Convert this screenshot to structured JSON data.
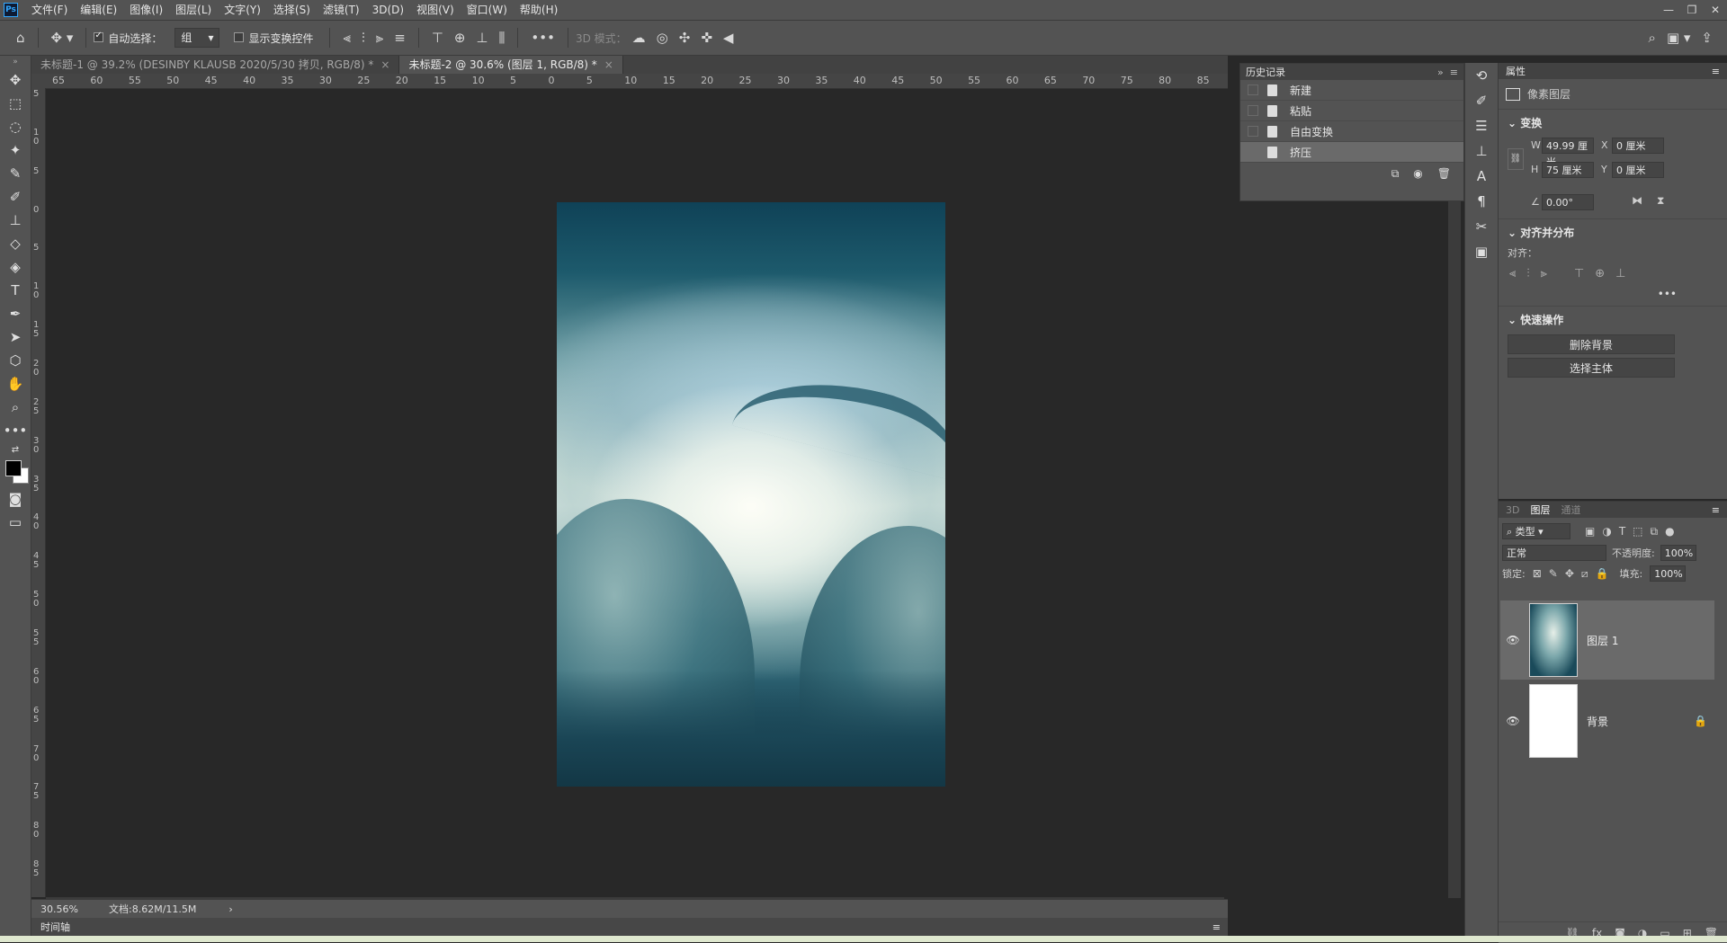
{
  "menubar": {
    "app_icon": "Ps",
    "items": [
      "文件(F)",
      "编辑(E)",
      "图像(I)",
      "图层(L)",
      "文字(Y)",
      "选择(S)",
      "滤镜(T)",
      "3D(D)",
      "视图(V)",
      "窗口(W)",
      "帮助(H)"
    ]
  },
  "options": {
    "auto_select_label": "自动选择：",
    "auto_select_value": "组",
    "show_transform_label": "显示变换控件",
    "mode_3d_label": "3D 模式："
  },
  "tabs": [
    {
      "label": "未标题-1 @ 39.2% (DESINBY KLAUSB 2020/5/30 拷贝, RGB/8) *",
      "active": false
    },
    {
      "label": "未标题-2 @ 30.6% (图层 1, RGB/8) *",
      "active": true
    }
  ],
  "ruler": {
    "h_labels": [
      "65",
      "60",
      "55",
      "50",
      "45",
      "40",
      "35",
      "30",
      "25",
      "20",
      "15",
      "10",
      "5",
      "0",
      "5",
      "10",
      "15",
      "20",
      "25",
      "30",
      "35",
      "40",
      "45",
      "50",
      "55",
      "60",
      "65",
      "70",
      "75",
      "80",
      "85"
    ],
    "v_labels": [
      "5",
      "10",
      "5",
      "0",
      "5",
      "10",
      "15",
      "20",
      "25",
      "30",
      "35",
      "40",
      "45",
      "50",
      "55",
      "60",
      "65",
      "70",
      "75",
      "80",
      "85"
    ]
  },
  "history": {
    "title": "历史记录",
    "items": [
      {
        "label": "新建",
        "selected": false
      },
      {
        "label": "粘贴",
        "selected": false
      },
      {
        "label": "自由变换",
        "selected": false
      },
      {
        "label": "挤压",
        "selected": true
      }
    ]
  },
  "properties": {
    "title": "属性",
    "kind": "像素图层",
    "transform_title": "变换",
    "w_label": "W",
    "w_value": "49.99 厘米",
    "x_label": "X",
    "x_value": "0 厘米",
    "h_label": "H",
    "h_value": "75 厘米",
    "y_label": "Y",
    "y_value": "0 厘米",
    "angle_value": "0.00°",
    "align_title": "对齐并分布",
    "align_label": "对齐：",
    "quick_title": "快速操作",
    "remove_bg": "删除背景",
    "select_subject": "选择主体"
  },
  "layers_panel": {
    "tabs": [
      "3D",
      "图层",
      "通道"
    ],
    "active_tab": "图层",
    "filter": "类型",
    "blend_mode": "正常",
    "opacity_label": "不透明度:",
    "opacity_value": "100%",
    "lock_label": "锁定:",
    "fill_label": "填充:",
    "fill_value": "100%",
    "layers": [
      {
        "name": "图层 1",
        "selected": true,
        "visible": true
      },
      {
        "name": "背景",
        "selected": false,
        "visible": true,
        "locked": true
      }
    ]
  },
  "status": {
    "zoom": "30.56%",
    "doc_info": "文档:8.62M/11.5M",
    "timeline": "时间轴"
  },
  "colors": {
    "panel_bg": "#535353",
    "canvas_bg": "#282828",
    "selected_row": "#6a6a6a"
  }
}
